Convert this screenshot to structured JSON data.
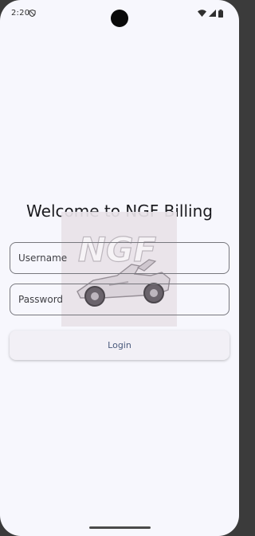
{
  "status_bar": {
    "time": "2:20",
    "icons": [
      "shield-icon",
      "wifi-icon",
      "signal-icon",
      "battery-icon"
    ]
  },
  "login": {
    "title": "Welcome to NGF Billing",
    "username_placeholder": "Username",
    "password_placeholder": "Password",
    "login_label": "Login",
    "logo_text": "NGF"
  },
  "colors": {
    "background": "#f7f7fd",
    "field_border": "#77777d",
    "button_bg": "#f2f0f6",
    "button_text": "#4a5a7c"
  }
}
